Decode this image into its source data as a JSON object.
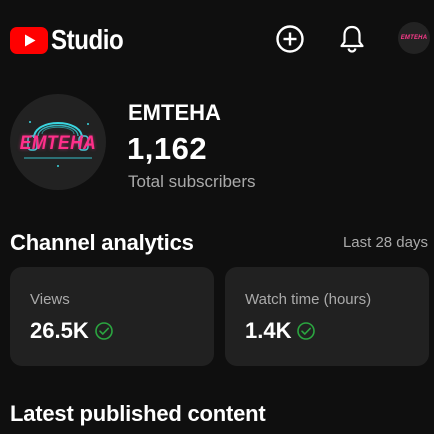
{
  "header": {
    "brand": "Studio",
    "avatar_text": "EMTEHA",
    "icons": [
      "youtube-logo-icon",
      "create-icon",
      "bell-icon"
    ]
  },
  "channel": {
    "avatar_text": "EMTEHA",
    "name": "EMTEHA",
    "subscriber_count": "1,162",
    "subscriber_label": "Total subscribers"
  },
  "analytics": {
    "title": "Channel analytics",
    "period": "Last 28 days",
    "cards": [
      {
        "label": "Views",
        "value": "26.5K",
        "status_icon": "check-circle-icon"
      },
      {
        "label": "Watch time (hours)",
        "value": "1.4K",
        "status_icon": "check-circle-icon"
      }
    ]
  },
  "latest": {
    "title": "Latest published content"
  },
  "colors": {
    "background": "#0f0f0f",
    "card": "#212121",
    "brand_red": "#ff0000",
    "check_green": "#2ba640",
    "neon_pink": "#ff2f8a",
    "neon_cyan": "#3ad6e0"
  }
}
